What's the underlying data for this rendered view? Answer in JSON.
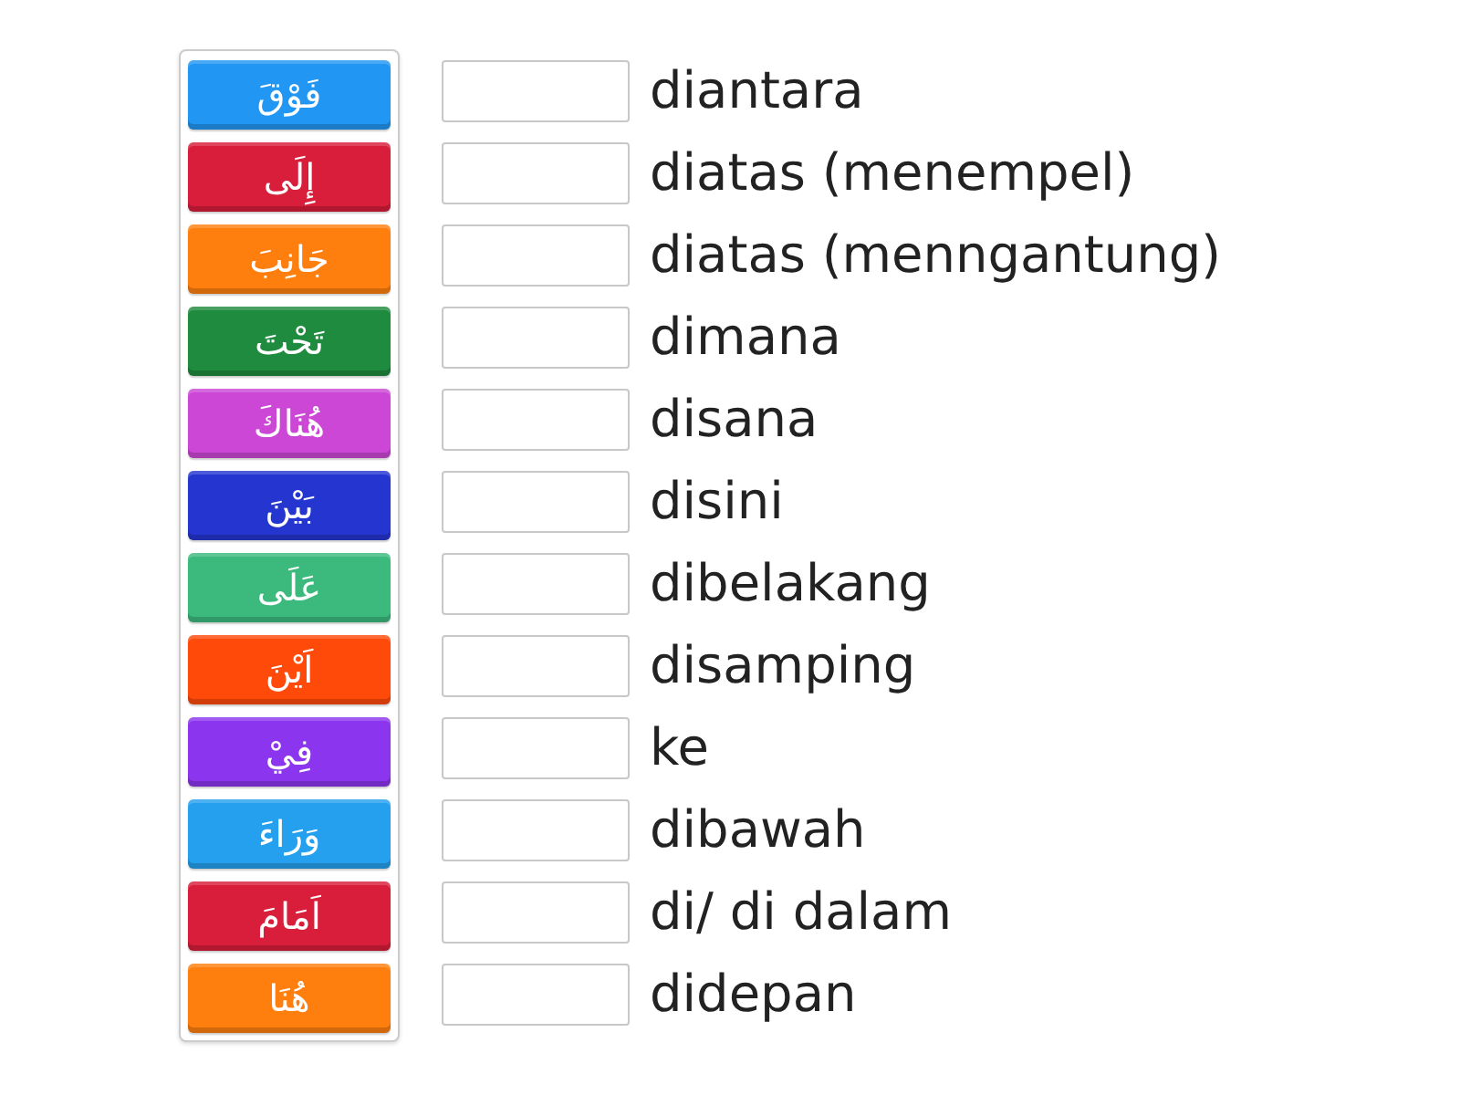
{
  "tiles": [
    {
      "text": "فَوْقَ",
      "color": "#2196f3"
    },
    {
      "text": "إِلَى",
      "color": "#d81e3b"
    },
    {
      "text": "جَانِبَ",
      "color": "#ff7f0e"
    },
    {
      "text": "تَحْتَ",
      "color": "#1f8b3e"
    },
    {
      "text": "هُنَاكَ",
      "color": "#cc47d6"
    },
    {
      "text": "بَيْنَ",
      "color": "#2535d0"
    },
    {
      "text": "عَلَى",
      "color": "#3cba7e"
    },
    {
      "text": "اَيْنَ",
      "color": "#ff4a0a"
    },
    {
      "text": "فِيْ",
      "color": "#8b35ee"
    },
    {
      "text": "وَرَاءَ",
      "color": "#24a0ee"
    },
    {
      "text": "اَمَامَ",
      "color": "#d81e3b"
    },
    {
      "text": "هُنَا",
      "color": "#ff7f0e"
    }
  ],
  "rows": [
    {
      "label": "diantara"
    },
    {
      "label": "diatas (menempel)"
    },
    {
      "label": "diatas (menngantung)"
    },
    {
      "label": "dimana"
    },
    {
      "label": "disana"
    },
    {
      "label": "disini"
    },
    {
      "label": "dibelakang"
    },
    {
      "label": "disamping"
    },
    {
      "label": "ke"
    },
    {
      "label": "dibawah"
    },
    {
      "label": "di/ di dalam"
    },
    {
      "label": "didepan"
    }
  ]
}
